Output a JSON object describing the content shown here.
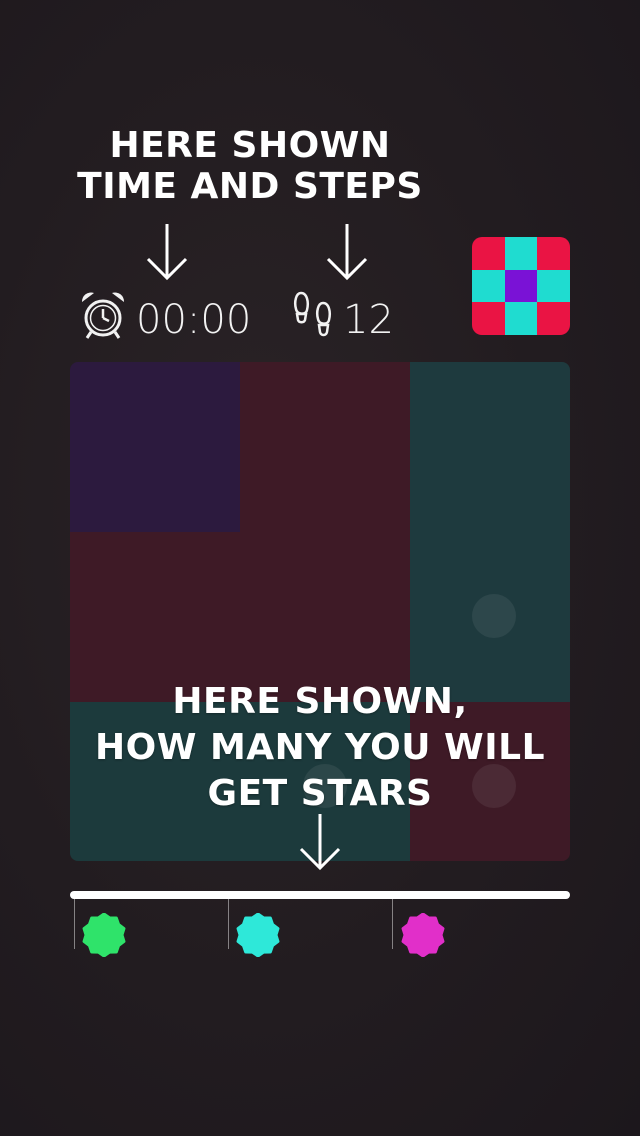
{
  "annotations": {
    "top_lines": [
      "HERE SHOWN",
      "TIME AND STEPS"
    ],
    "bottom_lines": [
      "HERE SHOWN,",
      "HOW MANY YOU WILL",
      "GET STARS"
    ]
  },
  "hud": {
    "time": "00:00",
    "steps": "12",
    "time_icon": "alarm-clock-icon",
    "steps_icon": "footprints-icon"
  },
  "target_pattern": {
    "colors": {
      "red": "#ea1444",
      "cyan": "#1fdcd0",
      "purple": "#7a12d6"
    },
    "grid": [
      [
        "red",
        "cyan",
        "red"
      ],
      [
        "cyan",
        "purple",
        "cyan"
      ],
      [
        "red",
        "cyan",
        "red"
      ]
    ]
  },
  "board": {
    "colors": {
      "purple": "#2c1a3e",
      "red": "#3e1a26",
      "teal": "#1e3a3e",
      "teal_bottom": "#1c3a3c"
    }
  },
  "stars": {
    "colors": [
      "#2fe36a",
      "#2ee8d9",
      "#e12fc9"
    ],
    "icons": [
      "star-badge-green-icon",
      "star-badge-cyan-icon",
      "star-badge-magenta-icon"
    ]
  }
}
